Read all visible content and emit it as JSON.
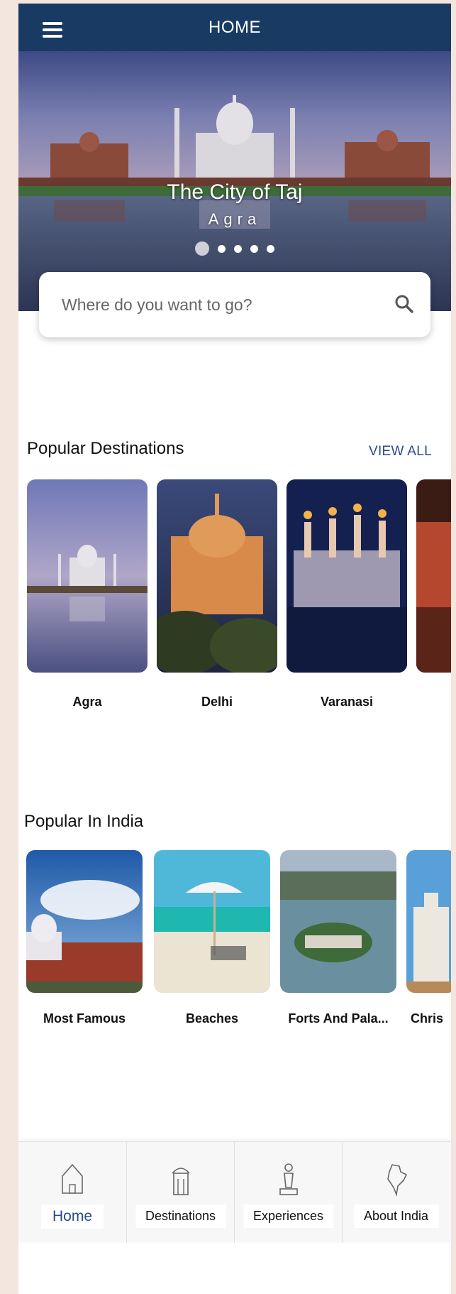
{
  "header": {
    "title": "HOME",
    "menu_icon": "hamburger-menu-icon"
  },
  "hero": {
    "title": "The City of Taj",
    "subtitle": "Agra",
    "slide_count": 5,
    "active_slide": 1
  },
  "search": {
    "placeholder": "Where do you want to go?",
    "icon": "search-icon"
  },
  "popular_destinations": {
    "title": "Popular Destinations",
    "view_all": "VIEW ALL",
    "items": [
      {
        "label": "Agra"
      },
      {
        "label": "Delhi"
      },
      {
        "label": "Varanasi"
      },
      {
        "label": ""
      }
    ]
  },
  "popular_in_india": {
    "title": "Popular In India",
    "items": [
      {
        "label": "Most Famous"
      },
      {
        "label": "Beaches"
      },
      {
        "label": "Forts And Pala..."
      },
      {
        "label": "Chris"
      }
    ]
  },
  "bottom_nav": {
    "items": [
      {
        "label": "Home",
        "icon": "home-icon",
        "active": true
      },
      {
        "label": "Destinations",
        "icon": "monument-icon",
        "active": false
      },
      {
        "label": "Experiences",
        "icon": "statue-icon",
        "active": false
      },
      {
        "label": "About India",
        "icon": "india-map-icon",
        "active": false
      }
    ]
  },
  "colors": {
    "header": "#183a63",
    "accent": "#2b4a8a",
    "page_background": "#f3e6df"
  }
}
